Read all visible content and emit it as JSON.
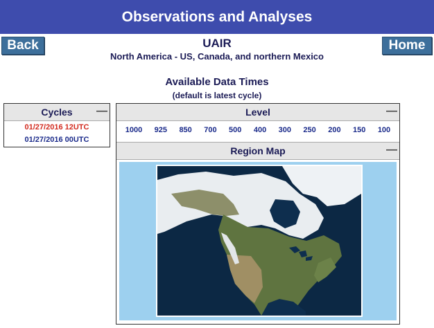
{
  "header": {
    "title": "Observations and Analyses"
  },
  "nav": {
    "back_label": "Back",
    "home_label": "Home"
  },
  "product": {
    "title": "UAIR",
    "subtitle": "North America - US, Canada, and northern Mexico"
  },
  "availability": {
    "title": "Available Data Times",
    "note": "(default is latest cycle)"
  },
  "cycles": {
    "header": "Cycles",
    "collapse_symbol": "—",
    "items": [
      {
        "label": "01/27/2016 12UTC",
        "active": true
      },
      {
        "label": "01/27/2016 00UTC",
        "active": false
      }
    ]
  },
  "levels": {
    "header": "Level",
    "collapse_symbol": "—",
    "values": [
      "1000",
      "925",
      "850",
      "700",
      "500",
      "400",
      "300",
      "250",
      "200",
      "150",
      "100"
    ]
  },
  "region_map": {
    "header": "Region Map",
    "collapse_symbol": "—"
  },
  "colors": {
    "banner": "#3e4cad",
    "button": "#3d6f9b",
    "active_cycle": "#d22a1e",
    "link": "#1a2a8a",
    "map_bg": "#9dd0ef"
  }
}
